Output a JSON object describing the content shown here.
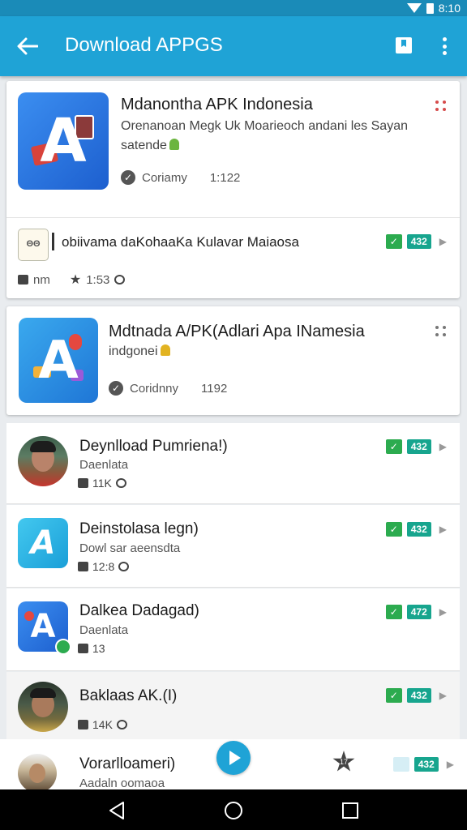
{
  "status_bar": {
    "time": "8:10"
  },
  "app_bar": {
    "title": "Download APPGS"
  },
  "featured": [
    {
      "title": "Mdanontha APK Indonesia",
      "description": "Orenanoan Megk Uk Moarieoch andani les Sayan satende",
      "status": "Coriamy",
      "count": "1:122"
    },
    {
      "title": "Mdtnada A/PK(Adlari Apa INamesia",
      "description": "indgonei",
      "status": "Coridnny",
      "count": "1192"
    }
  ],
  "promo_row": {
    "icon_text": "ΘΘ",
    "title": "obiivama daKohaaKa Kulavar Maiaosa",
    "stat_label": "nm",
    "rating": "1:53",
    "badge": "432"
  },
  "apps": [
    {
      "title": "Deynlload Pumriena!)",
      "subtitle": "Daenlata",
      "stats": "11K",
      "badge": "432"
    },
    {
      "title": "Deinstolasa legn)",
      "subtitle": "Dowl sar aeensdta",
      "stats": "12:8",
      "badge": "432"
    },
    {
      "title": "Dalkea Dadagad)",
      "subtitle": "Daenlata",
      "stats": "13",
      "badge": "472"
    },
    {
      "title": "Baklaas AK.(I)",
      "subtitle": "",
      "stats": "14K",
      "badge": "432"
    },
    {
      "title": "Vorarlloameri)",
      "subtitle": "Aadaln oomaoa",
      "stats": "",
      "badge": "432"
    }
  ],
  "bottom_badge": "17",
  "colors": {
    "primary": "#1fa3d6",
    "status_bar": "#1a8bb8",
    "green_check": "#2cab4f",
    "teal_badge": "#17a58e"
  },
  "icons": [
    "back-arrow",
    "bookmark",
    "more-vert",
    "check",
    "play",
    "star-badge",
    "nav-back",
    "nav-home",
    "nav-recents"
  ]
}
